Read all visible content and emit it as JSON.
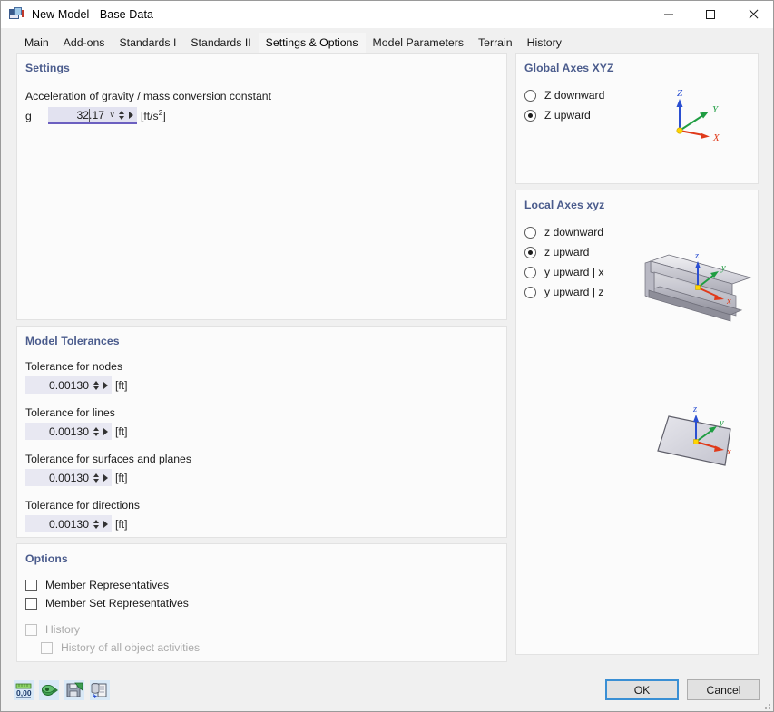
{
  "window": {
    "title": "New Model - Base Data",
    "icon": "new-model-icon",
    "minimize": "—",
    "maximize": "□",
    "close": "✕"
  },
  "tabs": [
    {
      "label": "Main",
      "active": false
    },
    {
      "label": "Add-ons",
      "active": false
    },
    {
      "label": "Standards I",
      "active": false
    },
    {
      "label": "Standards II",
      "active": false
    },
    {
      "label": "Settings & Options",
      "active": true
    },
    {
      "label": "Model Parameters",
      "active": false
    },
    {
      "label": "Terrain",
      "active": false
    },
    {
      "label": "History",
      "active": false
    }
  ],
  "settings": {
    "title": "Settings",
    "gravity_label": "Acceleration of gravity / mass conversion constant",
    "g_symbol": "g",
    "g_value": "32.17",
    "g_unit": "[ft/s",
    "g_unit_sup": "2",
    "g_unit_end": "]",
    "dropdown_chevron": "∨"
  },
  "tolerances": {
    "title": "Model Tolerances",
    "items": [
      {
        "label": "Tolerance for nodes",
        "value": "0.00130",
        "unit": "[ft]"
      },
      {
        "label": "Tolerance for lines",
        "value": "0.00130",
        "unit": "[ft]"
      },
      {
        "label": "Tolerance for surfaces and planes",
        "value": "0.00130",
        "unit": "[ft]"
      },
      {
        "label": "Tolerance for directions",
        "value": "0.00130",
        "unit": "[ft]"
      }
    ]
  },
  "options": {
    "title": "Options",
    "items": [
      {
        "label": "Member Representatives",
        "checked": false,
        "disabled": false,
        "indent": 0
      },
      {
        "label": "Member Set Representatives",
        "checked": false,
        "disabled": false,
        "indent": 0
      },
      {
        "label": "History",
        "checked": false,
        "disabled": true,
        "indent": 0
      },
      {
        "label": "History of all object activities",
        "checked": false,
        "disabled": true,
        "indent": 1
      }
    ]
  },
  "global_axes": {
    "title": "Global Axes XYZ",
    "options": [
      {
        "label": "Z downward",
        "selected": false
      },
      {
        "label": "Z upward",
        "selected": true
      }
    ],
    "gizmo": {
      "z_label": "Z",
      "y_label": "Y",
      "x_label": "X",
      "z_color": "#2b4fd1",
      "y_color": "#1f9d42",
      "x_color": "#e03a1a",
      "origin_color": "#ffd400"
    }
  },
  "local_axes": {
    "title": "Local Axes xyz",
    "options": [
      {
        "label": "z downward",
        "selected": false
      },
      {
        "label": "z upward",
        "selected": true
      },
      {
        "label": "y upward | x",
        "selected": false
      },
      {
        "label": "y upward | z",
        "selected": false
      }
    ],
    "beam_gizmo": {
      "z_label": "z",
      "y_label": "y",
      "x_label": "x",
      "z_color": "#2b4fd1",
      "y_color": "#1f9d42",
      "x_color": "#e03a1a",
      "origin_color": "#ffd400"
    },
    "surface_gizmo": {
      "z_label": "z",
      "y_label": "y",
      "x_label": "x",
      "z_color": "#2b4fd1",
      "y_color": "#1f9d42",
      "x_color": "#e03a1a",
      "origin_color": "#ffd400"
    }
  },
  "footer": {
    "tools": [
      {
        "name": "units-icon",
        "title": "0,00"
      },
      {
        "name": "render-settings-icon",
        "title": ""
      },
      {
        "name": "save-settings-icon",
        "title": ""
      },
      {
        "name": "import-settings-icon",
        "title": ""
      }
    ],
    "ok_label": "OK",
    "cancel_label": "Cancel"
  },
  "colors": {
    "accent": "#4a5b8c",
    "focus_underline": "#6b5fc0",
    "field_bg": "#e8e8f2",
    "panel_bg": "#fbfbfb",
    "dialog_bg": "#f0f0f0",
    "primary_border": "#3a8fd4"
  }
}
